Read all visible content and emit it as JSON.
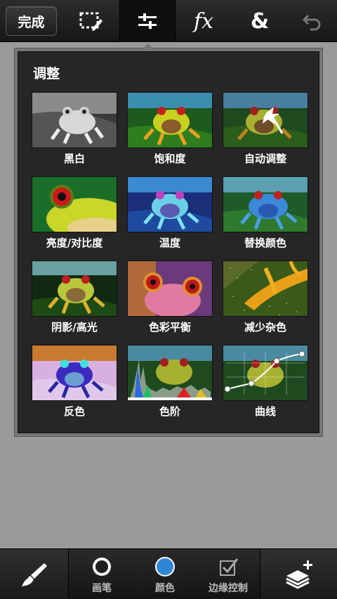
{
  "toolbar": {
    "done_label": "完成",
    "tools": [
      {
        "icon": "select-edit-icon"
      },
      {
        "icon": "adjust-sliders-icon",
        "active": true
      },
      {
        "icon": "fx-icon",
        "text": "fx"
      },
      {
        "icon": "ampersand-icon",
        "text": "&"
      },
      {
        "icon": "undo-icon"
      }
    ]
  },
  "panel": {
    "title": "调整",
    "items": [
      {
        "label": "黑白",
        "thumb": "frog-black-white"
      },
      {
        "label": "饱和度",
        "thumb": "frog-saturation"
      },
      {
        "label": "自动调整",
        "thumb": "frog-auto-adjust"
      },
      {
        "label": "亮度/对比度",
        "thumb": "frog-brightness-contrast"
      },
      {
        "label": "温度",
        "thumb": "frog-temperature"
      },
      {
        "label": "替换颜色",
        "thumb": "frog-replace-color"
      },
      {
        "label": "阴影/高光",
        "thumb": "frog-shadow-highlight"
      },
      {
        "label": "色彩平衡",
        "thumb": "frog-color-balance"
      },
      {
        "label": "减少杂色",
        "thumb": "frog-reduce-noise"
      },
      {
        "label": "反色",
        "thumb": "frog-invert"
      },
      {
        "label": "色阶",
        "thumb": "frog-levels"
      },
      {
        "label": "曲线",
        "thumb": "frog-curves"
      }
    ]
  },
  "bottombar": {
    "brush_icon": "paintbrush-icon",
    "buttons": [
      {
        "label": "画笔",
        "icon": "brush-size-icon"
      },
      {
        "label": "颜色",
        "icon": "color-swatch-icon",
        "color": "#2f86d6"
      },
      {
        "label": "边缘控制",
        "icon": "edge-control-icon"
      }
    ],
    "layers_icon": "layers-add-icon"
  },
  "colors": {
    "accent_blue": "#2f86d6",
    "panel_bg": "#262626",
    "page_bg": "#9a9a9a"
  }
}
